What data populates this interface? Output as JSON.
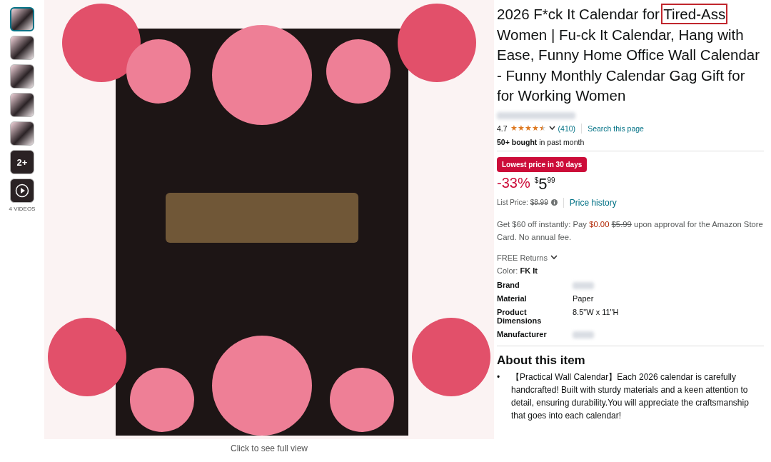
{
  "gallery": {
    "thumbnails": [
      {
        "kind": "image",
        "selected": true
      },
      {
        "kind": "image",
        "selected": false
      },
      {
        "kind": "image",
        "selected": false
      },
      {
        "kind": "image",
        "selected": false
      },
      {
        "kind": "image",
        "selected": false
      },
      {
        "kind": "more",
        "label": "2+",
        "selected": false
      },
      {
        "kind": "video",
        "selected": false
      }
    ],
    "videos_label": "4 VIDEOS",
    "full_view_link": "Click to see full view"
  },
  "product": {
    "title": [
      {
        "text": "2026 F*ck It Calendar for ",
        "highlighted": false
      },
      {
        "text": "Tired-Ass",
        "highlighted": true
      },
      {
        "text": " Women | Fu-ck It Calendar, Hang with Ease, Funny Home Office Wall Calendar - Funny Monthly Calendar Gag Gift for for Working Women",
        "highlighted": false
      }
    ],
    "rating": "4.7",
    "stars": 4.5,
    "review_count": "(410)",
    "search_link": "Search this page",
    "bought": "**50+ bought** in past month",
    "deal_badge": "Lowest price in 30 days",
    "discount": "-33%",
    "price_symbol": "$",
    "price_whole": "5",
    "price_fraction": "99",
    "list_price_label": "List Price:",
    "list_price": "$8.99",
    "price_history": "Price history",
    "card_offer": "Get $60 off instantly: Pay ",
    "card_offer_price": "$0.00",
    "card_offer_old": "$5.99",
    "card_offer_rest": " upon approval for the Amazon Store Card. No annual fee.",
    "returns": "FREE Returns",
    "color_label": "Color: ",
    "color_value": "FK It",
    "specs": [
      {
        "label": "Brand",
        "kind": "blurred"
      },
      {
        "label": "Material",
        "kind": "text",
        "value": "Paper"
      },
      {
        "label": "Product Dimensions",
        "kind": "text",
        "value": "8.5\"W x 11\"H"
      },
      {
        "label": "Manufacturer",
        "kind": "blurred"
      }
    ],
    "about_heading": "About this item",
    "about_bullets": [
      {
        "marker": "•",
        "text": "【Practical Wall Calendar】Each 2026 calendar is carefully handcrafted! Built with sturdy materials and a keen attention to detail, ensuring durability.You will appreciate the craftsmanship that goes into each calendar!"
      }
    ]
  }
}
